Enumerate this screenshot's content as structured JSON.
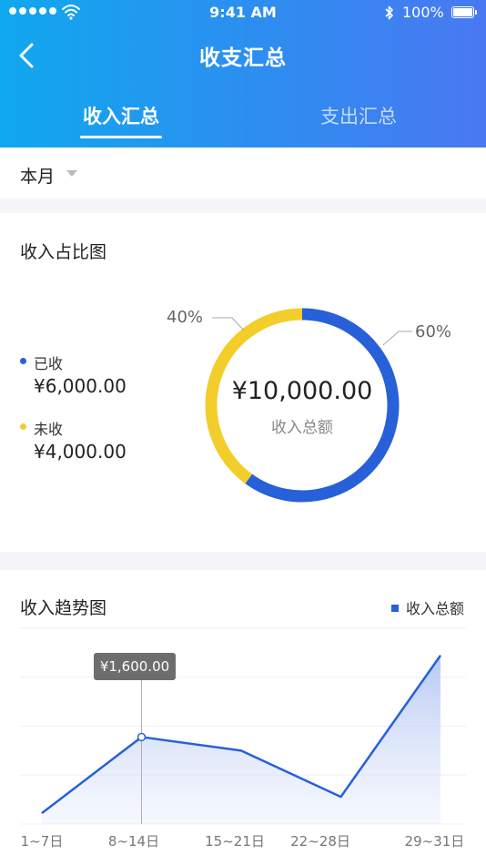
{
  "status_bar": {
    "time": "9:41 AM",
    "battery": "100%"
  },
  "nav": {
    "title": "收支汇总",
    "back_icon": "chevron-left-icon"
  },
  "tabs": [
    {
      "label": "收入汇总",
      "active": true
    },
    {
      "label": "支出汇总",
      "active": false
    }
  ],
  "filter": {
    "period": "本月"
  },
  "income_ratio": {
    "title": "收入占比图",
    "items": [
      {
        "name": "已收",
        "amount": "¥6,000.00",
        "color": "#2760d8",
        "percent_label": "60%",
        "share": 0.6
      },
      {
        "name": "未收",
        "amount": "¥4,000.00",
        "color": "#f3cd29",
        "percent_label": "40%",
        "share": 0.4
      }
    ],
    "total": "¥10,000.00",
    "total_caption": "收入总额"
  },
  "trend": {
    "title": "收入趋势图",
    "legend": "收入总额",
    "tooltip": "¥1,600.00"
  },
  "chart_data": {
    "type": "area",
    "categories": [
      "1~7日",
      "8~14日",
      "15~21日",
      "22~28日",
      "29~31日"
    ],
    "series": [
      {
        "name": "收入总额",
        "values": [
          200,
          1600,
          1350,
          500,
          3100
        ]
      }
    ],
    "ylim": [
      0,
      3600
    ],
    "grid": true,
    "legend": "top-right",
    "highlight_index": 1,
    "color": "#2760d8"
  }
}
